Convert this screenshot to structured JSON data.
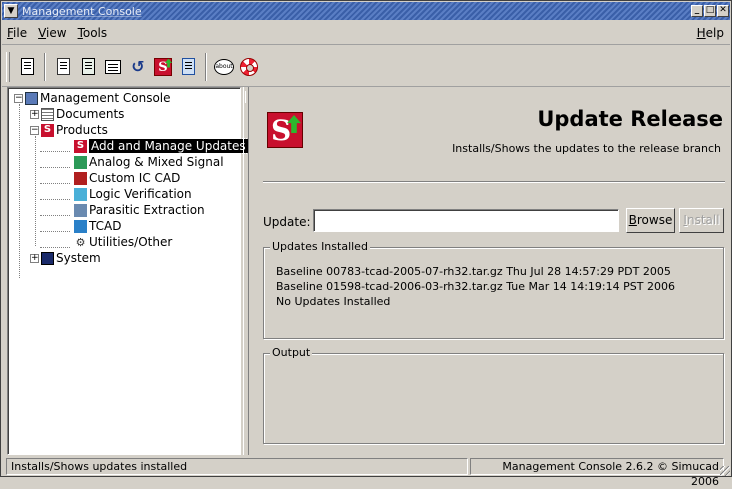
{
  "window": {
    "title": "Management Console",
    "buttons": [
      "minimize",
      "maximize",
      "close"
    ]
  },
  "menubar": {
    "items": [
      {
        "label": "File",
        "mnemonic": "F",
        "rest": "ile"
      },
      {
        "label": "View",
        "mnemonic": "V",
        "rest": "iew"
      },
      {
        "label": "Tools",
        "mnemonic": "T",
        "rest": "ools"
      }
    ],
    "help": {
      "label": "Help",
      "mnemonic": "H",
      "rest": "elp"
    }
  },
  "toolbar": {
    "buttons": [
      "new-document-icon",
      "export-icon",
      "import-icon",
      "print-icon",
      "refresh-icon",
      "simucad-update-icon",
      "bookmark-icon",
      "about-icon",
      "help-lifebuoy-icon"
    ]
  },
  "tree": {
    "root": "Management Console",
    "items": [
      {
        "label": "Documents",
        "icon": "documents-icon"
      },
      {
        "label": "Products",
        "icon": "products-icon"
      },
      {
        "label": "Add and Manage Updates",
        "icon": "updates-icon",
        "selected": true
      },
      {
        "label": "Analog & Mixed Signal",
        "icon": "analog-icon"
      },
      {
        "label": "Custom IC CAD",
        "icon": "custom-ic-icon"
      },
      {
        "label": "Logic Verification",
        "icon": "logic-icon"
      },
      {
        "label": "Parasitic Extraction",
        "icon": "parasitic-icon"
      },
      {
        "label": "TCAD",
        "icon": "tcad-icon"
      },
      {
        "label": "Utilities/Other",
        "icon": "utilities-icon"
      },
      {
        "label": "System",
        "icon": "system-icon"
      }
    ]
  },
  "panel": {
    "title": "Update Release",
    "subtitle": "Installs/Shows the updates to the release branch",
    "update_label": "Update:",
    "update_value": "",
    "browse": {
      "label": "Browse",
      "mnemonic": "B",
      "rest": "rowse"
    },
    "install": {
      "label": "Install",
      "mnemonic": "I",
      "rest": "nstall",
      "enabled": false
    },
    "installed_title": "Updates Installed",
    "installed": [
      "Baseline 00783-tcad-2005-07-rh32.tar.gz Thu Jul 28 14:57:29 PDT 2005",
      "Baseline 01598-tcad-2006-03-rh32.tar.gz Tue Mar 14 14:19:14 PST 2006",
      "No Updates Installed"
    ],
    "output_title": "Output",
    "output_text": ""
  },
  "status": {
    "left": "Installs/Shows updates installed",
    "right": "Management Console 2.6.2 © Simucad 2006"
  },
  "colors": {
    "title_bar": "#3a5fa8",
    "brand_red": "#c8102e",
    "brand_green": "#2db82d",
    "window_bg": "#d4d0c8"
  }
}
